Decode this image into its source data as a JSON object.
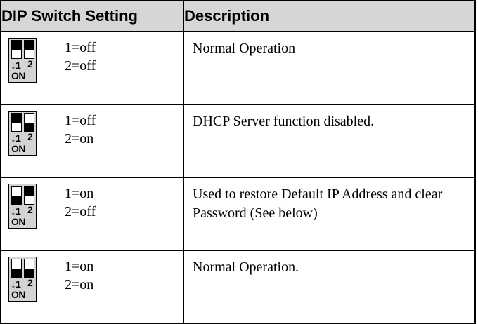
{
  "headers": {
    "setting": "DIP Switch Setting",
    "description": "Description"
  },
  "switch_label": {
    "arrow": "↓",
    "n1": "1",
    "n2": "2",
    "on": "ON"
  },
  "rows": [
    {
      "s1": "1=off",
      "s2": "2=off",
      "sw1_on": false,
      "sw2_on": false,
      "description": "Normal Operation"
    },
    {
      "s1": "1=off",
      "s2": "2=on",
      "sw1_on": false,
      "sw2_on": true,
      "description": "DHCP Server function disabled."
    },
    {
      "s1": "1=on",
      "s2": "2=off",
      "sw1_on": true,
      "sw2_on": false,
      "description": "Used to restore Default IP Address and clear Password (See below)"
    },
    {
      "s1": "1=on",
      "s2": "2=on",
      "sw1_on": true,
      "sw2_on": true,
      "description": "Normal Operation."
    }
  ]
}
